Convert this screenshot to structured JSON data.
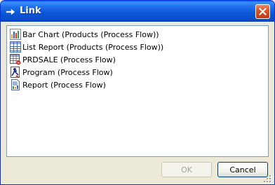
{
  "window": {
    "title": "Link",
    "title_icon": "arrow-right-icon",
    "close_icon": "close-icon"
  },
  "list": {
    "items": [
      {
        "label": "Bar Chart (Products (Process Flow))",
        "icon": "bar-chart-icon"
      },
      {
        "label": "List Report (Products (Process Flow))",
        "icon": "list-report-icon"
      },
      {
        "label": "PRDSALE (Process Flow)",
        "icon": "data-table-icon"
      },
      {
        "label": "Program (Process Flow)",
        "icon": "program-icon"
      },
      {
        "label": "Report (Process Flow)",
        "icon": "report-icon"
      }
    ]
  },
  "buttons": {
    "ok_label": "OK",
    "ok_enabled": false,
    "cancel_label": "Cancel"
  },
  "colors": {
    "title_bar": "#0a58d8",
    "dialog_bg": "#ece9d8",
    "close_button": "#d8552c"
  }
}
